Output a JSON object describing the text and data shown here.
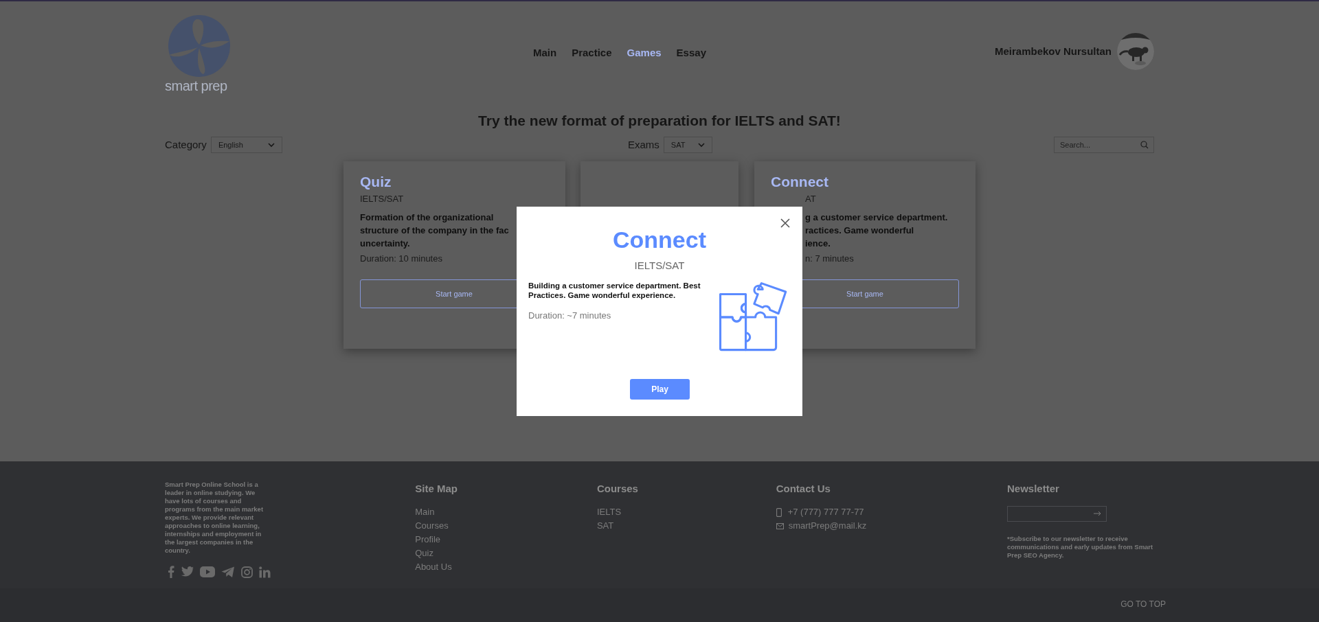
{
  "header": {
    "logo_text": "smart prep",
    "nav": [
      {
        "label": "Main",
        "selected": false
      },
      {
        "label": "Practice",
        "selected": false
      },
      {
        "label": "Games",
        "selected": true
      },
      {
        "label": "Essay",
        "selected": false
      }
    ],
    "user_name": "Meirambekov Nursultan"
  },
  "heading": "Try the new format of preparation for IELTS and SAT!",
  "filters": {
    "category_label": "Category",
    "category_value": "English",
    "exams_label": "Exams",
    "exams_value": "SAT",
    "search_placeholder": "Search..."
  },
  "cards": [
    {
      "kind": "full",
      "title": "Quiz",
      "subtitle": "IELTS/SAT",
      "description_lines": [
        "Formation of the organizational",
        "structure of the company in the fac",
        "uncertainty."
      ],
      "duration": "Duration: 10 minutes",
      "button": "Start game"
    },
    {
      "kind": "covered"
    },
    {
      "kind": "partial",
      "title": "Connect",
      "subtitle": "AT",
      "description_lines": [
        "g a customer service department.",
        "ractices. Game wonderful",
        "ience."
      ],
      "duration": "n: 7 minutes",
      "button": "Start game"
    }
  ],
  "modal": {
    "title": "Connect",
    "subtitle": "IELTS/SAT",
    "description": "Building a customer service department. Best Practices. Game wonderful experience.",
    "duration": "Duration: ~7 minutes",
    "button": "Play"
  },
  "footer": {
    "about": "Smart Prep Online School is a leader in online studying. We have lots of courses and programs from the main market experts. We provide relevant approaches to online learning, internships and employment in the largest companies in the country.",
    "site_map": {
      "title": "Site Map",
      "links": [
        "Main",
        "Courses",
        "Profile",
        "Quiz",
        "About Us"
      ]
    },
    "courses": {
      "title": "Courses",
      "links": [
        "IELTS",
        "SAT"
      ]
    },
    "contact": {
      "title": "Contact Us",
      "phone": "+7 (777) 777 77-77",
      "email": "smartPrep@mail.kz"
    },
    "newsletter": {
      "title": "Newsletter",
      "note": "*Subscribe to our newsletter to receive communications and early updates from Smart Prep SEO Agency."
    },
    "go_to_top": "GO TO TOP"
  }
}
